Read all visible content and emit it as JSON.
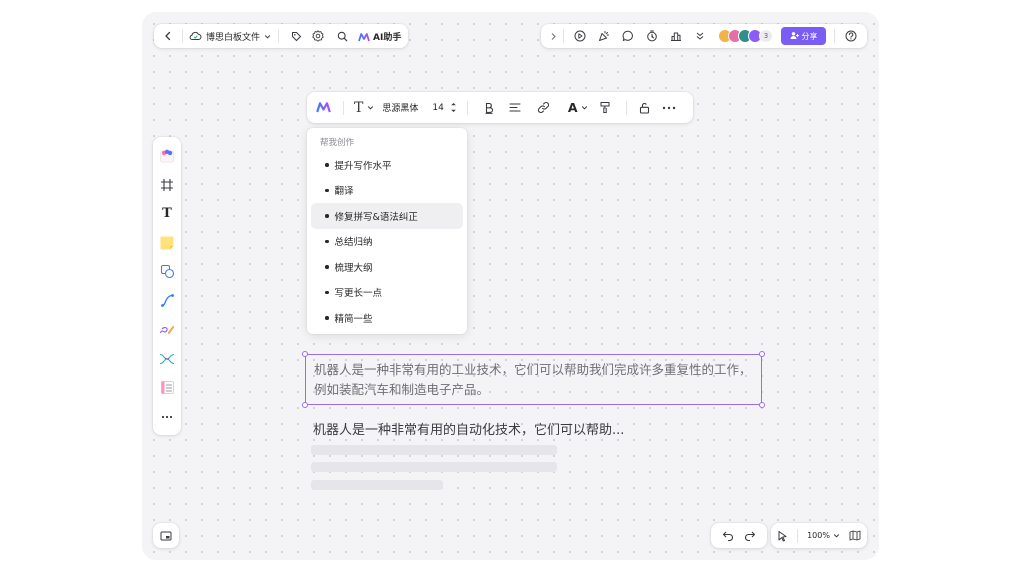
{
  "top_left": {
    "file_name": "博思白板文件",
    "ai_label": "AI助手"
  },
  "top_right": {
    "avatar_count": "3",
    "share_label": "分享",
    "avatar_colors": [
      "#f2b24a",
      "#e46fa8",
      "#2f8f8a",
      "#8b5cf6"
    ]
  },
  "format_bar": {
    "font_name": "思源黑体",
    "font_size": "14",
    "text_icon": "T",
    "color_icon": "A"
  },
  "left_rail": {
    "text_tool_icon": "T"
  },
  "ai_menu": {
    "header": "帮我创作",
    "items": [
      {
        "label": "提升写作水平"
      },
      {
        "label": "翻译"
      },
      {
        "label": "修复拼写&语法纠正",
        "active": true
      },
      {
        "label": "总结归纳"
      },
      {
        "label": "梳理大纲"
      },
      {
        "label": "写更长一点"
      },
      {
        "label": "精简一些"
      }
    ]
  },
  "canvas": {
    "selected_text": "机器人是一种非常有用的工业技术，它们可以帮助我们完成许多重复性的工作，例如装配汽车和制造电子产品。",
    "generating_text": "机器人是一种非常有用的自动化技术，它们可以帮助..."
  },
  "bottom_right": {
    "zoom": "100%"
  },
  "colors": {
    "accent": "#7b5cf5",
    "selection": "#9a6cf0"
  }
}
